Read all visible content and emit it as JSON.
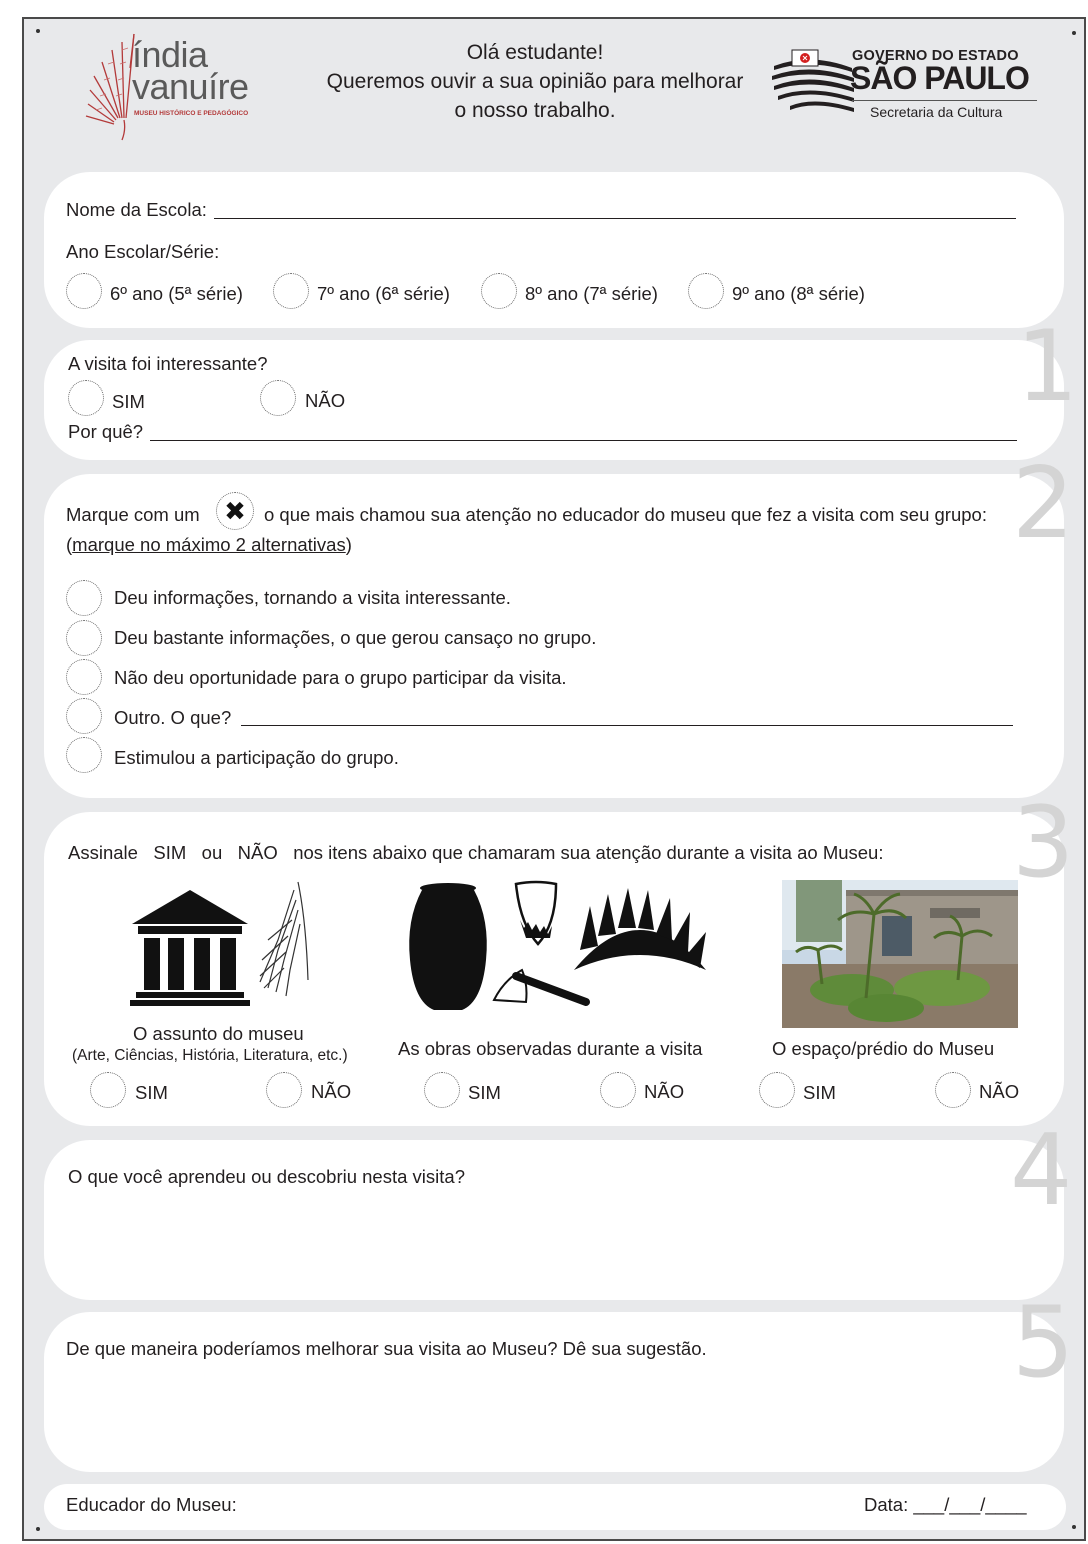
{
  "header": {
    "logo_left": {
      "line1": "índia",
      "line2": "vanuíre",
      "subtitle": "MUSEU HISTÓRICO E PEDAGÓGICO"
    },
    "greeting": {
      "line1": "Olá estudante!",
      "line2": "Queremos ouvir a sua opinião para melhorar",
      "line3": "o nosso trabalho."
    },
    "logo_right": {
      "line1": "GOVERNO DO ESTADO",
      "line2": "SÃO PAULO",
      "line3": "Secretaria da Cultura"
    }
  },
  "school": {
    "name_label": "Nome da Escola:",
    "grade_label": "Ano Escolar/Série:",
    "grades": [
      "6º ano (5ª série)",
      "7º ano (6ª série)",
      "8º ano (7ª série)",
      "9º ano (8ª série)"
    ]
  },
  "q1": {
    "number": "1",
    "question": "A visita foi interessante?",
    "yes": "SIM",
    "no": "NÃO",
    "why_label": "Por quê?"
  },
  "q2": {
    "number": "2",
    "prompt_before": "Marque com um",
    "mark_symbol": "✖",
    "prompt_after": "o que mais chamou sua atenção no educador do museu que fez a visita com seu grupo:",
    "note_open": "(",
    "note": "marque no máximo 2 alternativas",
    "note_close": ")",
    "options": [
      "Deu informações, tornando a visita interessante.",
      "Deu bastante informações, o que gerou cansaço no grupo.",
      "Não deu oportunidade para o grupo participar da visita.",
      "Outro. O que?",
      "Estimulou a participação do grupo."
    ]
  },
  "q3": {
    "number": "3",
    "prompt_1": "Assinale",
    "prompt_sim": "SIM",
    "prompt_ou": "ou",
    "prompt_nao": "NÃO",
    "prompt_2": "nos itens abaixo que chamaram sua atenção durante a visita ao Museu:",
    "items": [
      {
        "title": "O assunto do museu",
        "subtitle": "(Arte, Ciências, História, Literatura, etc.)",
        "yes": "SIM",
        "no": "NÃO"
      },
      {
        "title": "As obras observadas durante a visita",
        "yes": "SIM",
        "no": "NÃO"
      },
      {
        "title": "O espaço/prédio do Museu",
        "yes": "SIM",
        "no": "NÃO"
      }
    ]
  },
  "q4": {
    "number": "4",
    "question": "O que você aprendeu ou descobriu nesta visita?"
  },
  "q5": {
    "number": "5",
    "question": "De que maneira poderíamos melhorar sua visita ao Museu? Dê sua sugestão."
  },
  "footer": {
    "educator_label": "Educador do Museu:",
    "date_label": "Data: ___/___/____"
  },
  "colors": {
    "background": "#e8e9eb",
    "panel": "#ffffff",
    "number": "#d4d4d4",
    "logo_red": "#b33a3a"
  }
}
